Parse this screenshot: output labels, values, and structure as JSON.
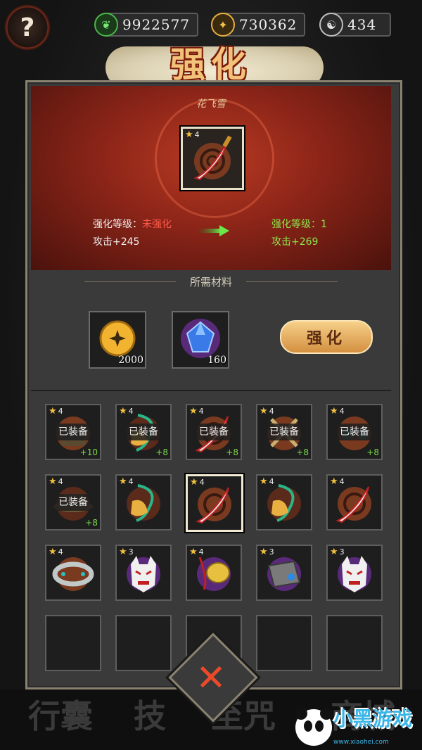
{
  "resources": [
    {
      "icon": "jade-icon",
      "value": "9922577"
    },
    {
      "icon": "gold-coin-icon",
      "value": "730362"
    },
    {
      "icon": "spirit-orb-icon",
      "value": "434"
    }
  ],
  "help_label": "?",
  "title": "强化",
  "item": {
    "name": "花飞雪",
    "stars": 4,
    "current": {
      "level_label": "强化等级：",
      "level_value": "未强化",
      "attack": "攻击+245"
    },
    "next": {
      "level_label": "强化等级：",
      "level_value": "1",
      "attack": "攻击+269"
    }
  },
  "materials": {
    "header": "所需材料",
    "items": [
      {
        "icon": "gold-coin-icon",
        "qty": "2000"
      },
      {
        "icon": "blue-crystal-icon",
        "qty": "160"
      }
    ],
    "button_label": "强化"
  },
  "inventory": {
    "equipped_label": "已装备",
    "slots": [
      {
        "icon": "leather-armor-icon",
        "stars": "4",
        "equipped": true,
        "plus": "+10"
      },
      {
        "icon": "jade-pendant-icon",
        "stars": "4",
        "equipped": true,
        "plus": "+8"
      },
      {
        "icon": "sword-icon",
        "stars": "4",
        "equipped": true,
        "plus": "+8"
      },
      {
        "icon": "crossed-axes-icon",
        "stars": "4",
        "equipped": true,
        "plus": "+8"
      },
      {
        "icon": "goggles-icon",
        "stars": "4",
        "equipped": true,
        "plus": "+8"
      },
      {
        "icon": "hat-icon",
        "stars": "4",
        "equipped": true,
        "plus": "+8"
      },
      {
        "icon": "jade-pendant-icon",
        "stars": "4",
        "equipped": false,
        "plus": ""
      },
      {
        "icon": "sword-icon",
        "stars": "4",
        "equipped": false,
        "plus": "",
        "selected": true
      },
      {
        "icon": "jade-pendant-icon",
        "stars": "4",
        "equipped": false,
        "plus": ""
      },
      {
        "icon": "sword-icon",
        "stars": "4",
        "equipped": false,
        "plus": ""
      },
      {
        "icon": "silver-bracelet-icon",
        "stars": "4",
        "equipped": false,
        "plus": ""
      },
      {
        "icon": "oni-mask-icon",
        "stars": "3",
        "equipped": false,
        "plus": ""
      },
      {
        "icon": "gold-amulet-icon",
        "stars": "4",
        "equipped": false,
        "plus": ""
      },
      {
        "icon": "cleaver-icon",
        "stars": "3",
        "equipped": false,
        "plus": ""
      },
      {
        "icon": "oni-mask-icon",
        "stars": "3",
        "equipped": false,
        "plus": ""
      },
      {
        "icon": "",
        "stars": "",
        "equipped": false,
        "plus": ""
      },
      {
        "icon": "",
        "stars": "",
        "equipped": false,
        "plus": ""
      },
      {
        "icon": "",
        "stars": "",
        "equipped": false,
        "plus": ""
      },
      {
        "icon": "",
        "stars": "",
        "equipped": false,
        "plus": ""
      },
      {
        "icon": "",
        "stars": "",
        "equipped": false,
        "plus": ""
      }
    ]
  },
  "close_label": "✕",
  "background_tabs": [
    "行囊",
    "技",
    "至咒",
    "商城"
  ],
  "watermark": {
    "text": "小黑游戏",
    "url": "www.xiaohei.com"
  },
  "colors": {
    "accent_red": "#ff5a4a",
    "accent_green": "#8ce84a",
    "gold": "#f2c27a"
  }
}
